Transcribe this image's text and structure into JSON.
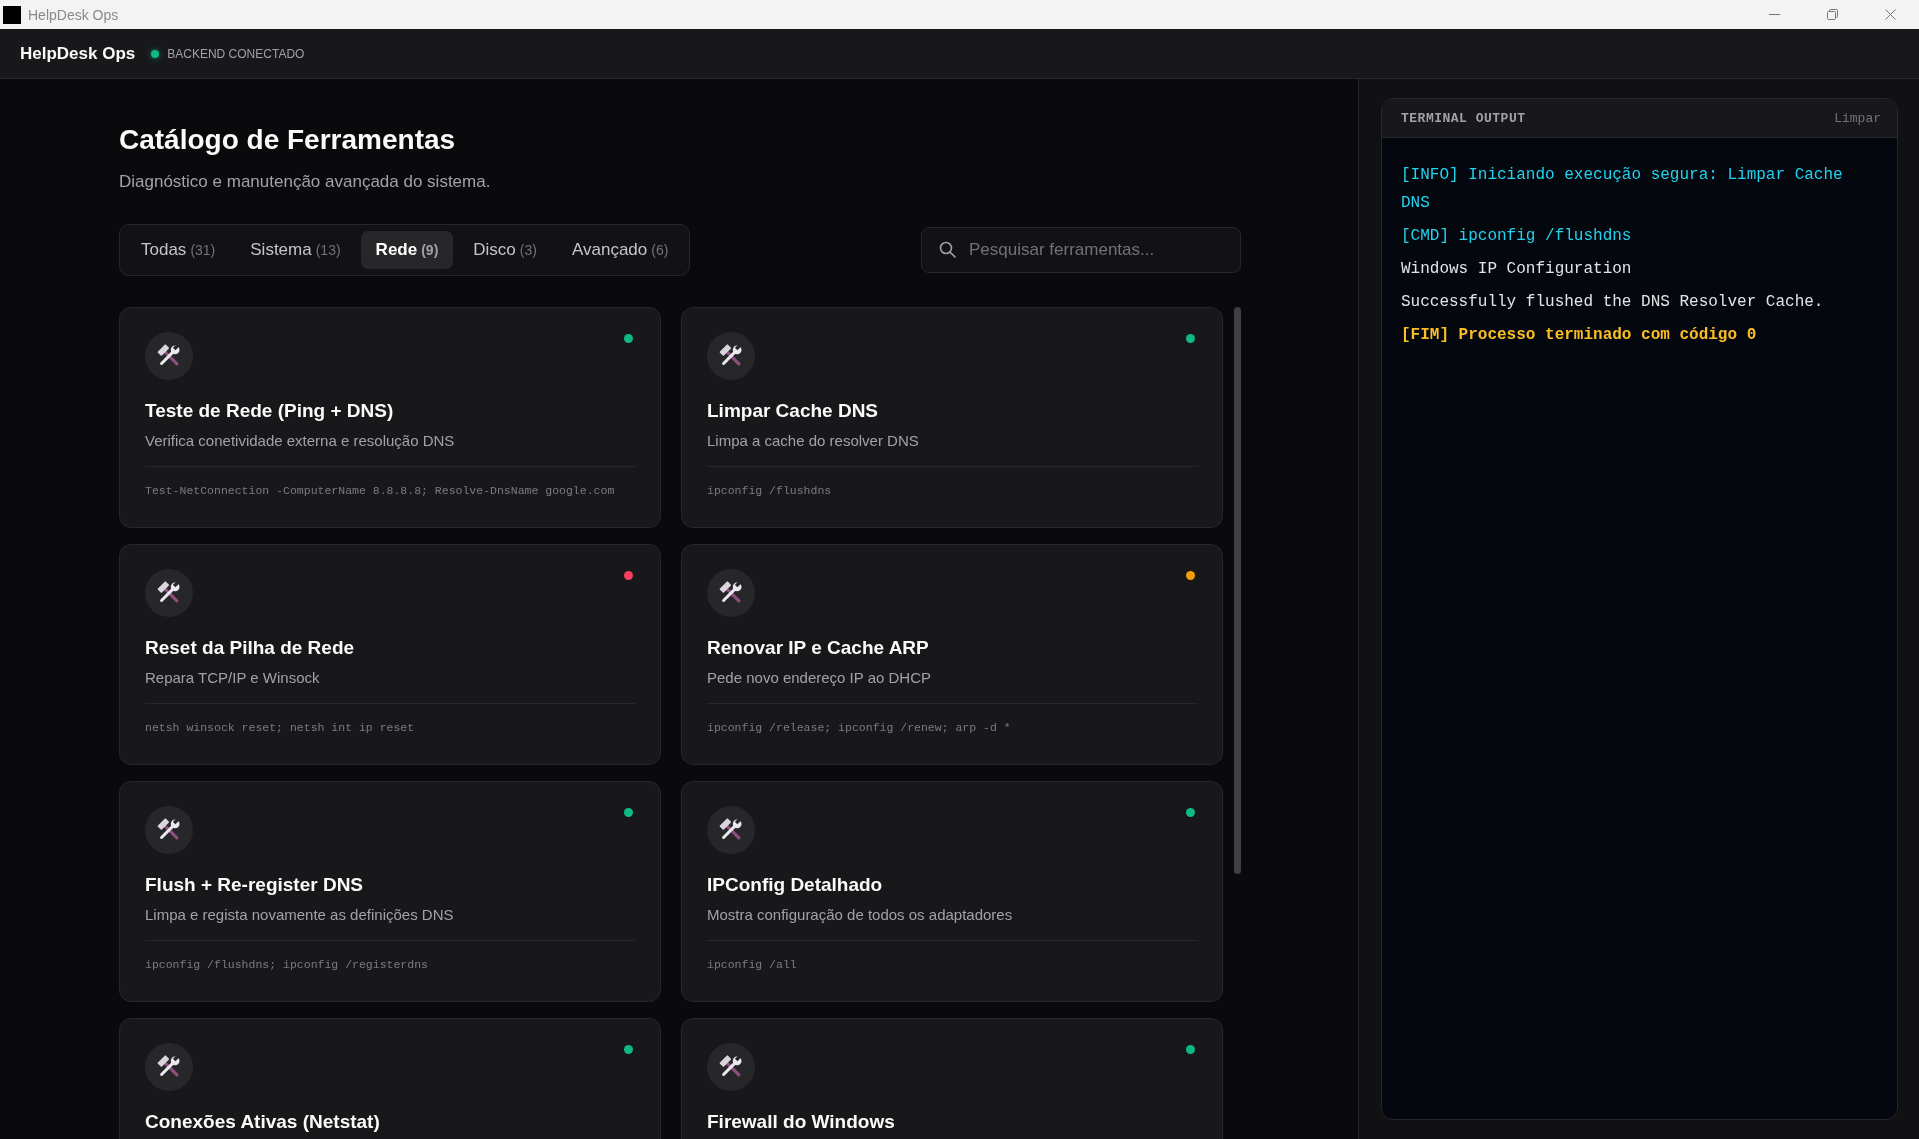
{
  "window": {
    "title": "HelpDesk Ops"
  },
  "app_bar": {
    "brand": "HelpDesk Ops",
    "backend": {
      "label": "BACKEND CONECTADO",
      "connected": true
    }
  },
  "catalog": {
    "title": "Catálogo de Ferramentas",
    "subtitle": "Diagnóstico e manutenção avançada do sistema.",
    "tabs": [
      {
        "label": "Todas",
        "count": "(31)",
        "selected": false
      },
      {
        "label": "Sistema",
        "count": "(13)",
        "selected": false
      },
      {
        "label": "Rede",
        "count": "(9)",
        "selected": true
      },
      {
        "label": "Disco",
        "count": "(3)",
        "selected": false
      },
      {
        "label": "Avançado",
        "count": "(6)",
        "selected": false
      }
    ],
    "search": {
      "placeholder": "Pesquisar ferramentas..."
    },
    "tools": [
      {
        "title": "Teste de Rede (Ping + DNS)",
        "description": "Verifica conetividade externa e resolução DNS",
        "command": "Test-NetConnection -ComputerName 8.8.8.8; Resolve-DnsName google.com",
        "color": "#10b981"
      },
      {
        "title": "Limpar Cache DNS",
        "description": "Limpa a cache do resolver DNS",
        "command": "ipconfig /flushdns",
        "color": "#10b981"
      },
      {
        "title": "Reset da Pilha de Rede",
        "description": "Repara TCP/IP e Winsock",
        "command": "netsh winsock reset; netsh int ip reset",
        "color": "#f43f5e"
      },
      {
        "title": "Renovar IP e Cache ARP",
        "description": "Pede novo endereço IP ao DHCP",
        "command": "ipconfig /release; ipconfig /renew; arp -d *",
        "color": "#f59e0b"
      },
      {
        "title": "Flush + Re-register DNS",
        "description": "Limpa e regista novamente as definições DNS",
        "command": "ipconfig /flushdns; ipconfig /registerdns",
        "color": "#10b981"
      },
      {
        "title": "IPConfig Detalhado",
        "description": "Mostra configuração de todos os adaptadores",
        "command": "ipconfig /all",
        "color": "#10b981"
      },
      {
        "title": "Conexões Ativas (Netstat)",
        "color": "#10b981"
      },
      {
        "title": "Firewall do Windows",
        "color": "#10b981"
      }
    ]
  },
  "terminal": {
    "title": "TERMINAL OUTPUT",
    "clear_label": "Limpar",
    "lines": [
      {
        "kind": "info",
        "text": "[INFO] Iniciando execução segura: Limpar Cache DNS"
      },
      {
        "kind": "cmd",
        "text": "[CMD] ipconfig /flushdns"
      },
      {
        "kind": "output",
        "text": "Windows IP Configuration"
      },
      {
        "kind": "output",
        "text": "Successfully flushed the DNS Resolver Cache."
      },
      {
        "kind": "end",
        "text": "[FIM] Processo terminado com código 0"
      }
    ]
  }
}
